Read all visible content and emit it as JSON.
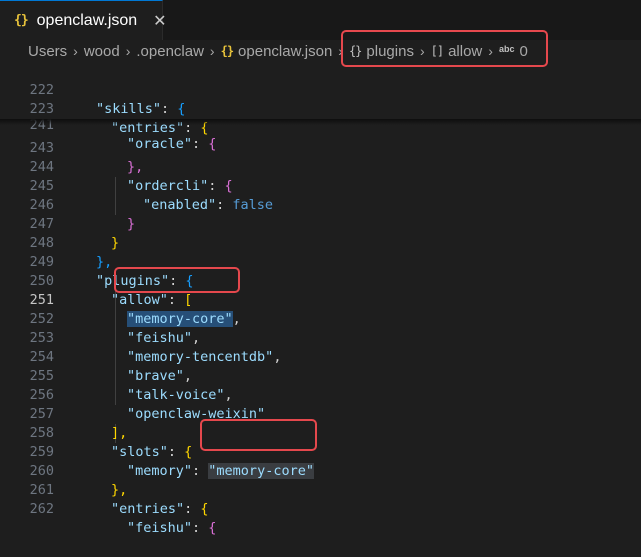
{
  "tab": {
    "icon": "{}",
    "title": "openclaw.json",
    "close": "✕"
  },
  "breadcrumb": {
    "items": [
      "Users",
      "wood",
      ".openclaw",
      "openclaw.json",
      "plugins",
      "allow",
      "0"
    ],
    "file_icon": "{}",
    "obj_icon": "{}",
    "arr_icon": "[]",
    "abc_icon": "abc",
    "separator": "›"
  },
  "editor": {
    "lines": [
      {
        "n": "222",
        "t": "\"skills\": {"
      },
      {
        "n": "223",
        "t": "\"entries\": {"
      },
      {
        "n": "241",
        "t": "\"oracle\": {"
      },
      {
        "n": "243",
        "t": "},"
      },
      {
        "n": "244",
        "t": "\"ordercli\": {"
      },
      {
        "n": "245",
        "t": "\"enabled\": false"
      },
      {
        "n": "246",
        "t": "}"
      },
      {
        "n": "247",
        "t": "}"
      },
      {
        "n": "248",
        "t": "},"
      },
      {
        "n": "249",
        "t": "\"plugins\": {"
      },
      {
        "n": "250",
        "t": "\"allow\": ["
      },
      {
        "n": "251",
        "t": "\"memory-core\","
      },
      {
        "n": "252",
        "t": "\"feishu\","
      },
      {
        "n": "253",
        "t": "\"memory-tencentdb\","
      },
      {
        "n": "254",
        "t": "\"brave\","
      },
      {
        "n": "255",
        "t": "\"talk-voice\","
      },
      {
        "n": "256",
        "t": "\"openclaw-weixin\""
      },
      {
        "n": "257",
        "t": "],"
      },
      {
        "n": "258",
        "t": "\"slots\": {"
      },
      {
        "n": "259",
        "t": "\"memory\": \"memory-core\""
      },
      {
        "n": "260",
        "t": "},"
      },
      {
        "n": "261",
        "t": "\"entries\": {"
      },
      {
        "n": "262",
        "t": "\"feishu\": {"
      }
    ],
    "tokens": {
      "skills": "\"skills\"",
      "entries": "\"entries\"",
      "oracle": "\"oracle\"",
      "ordercli": "\"ordercli\"",
      "enabled": "\"enabled\"",
      "false": "false",
      "plugins": "\"plugins\"",
      "allow": "\"allow\"",
      "memory_core": "\"memory-core\"",
      "feishu": "\"feishu\"",
      "memory_tencentdb": "\"memory-tencentdb\"",
      "brave": "\"brave\"",
      "talk_voice": "\"talk-voice\"",
      "openclaw_weixin": "\"openclaw-weixin\"",
      "slots": "\"slots\"",
      "memory": "\"memory\"",
      "colon": ": ",
      "comma": ",",
      "lbrace": "{",
      "rbrace": "}",
      "rbrace_comma": "},",
      "lbracket": "[",
      "rbracket_comma": "],"
    }
  },
  "colors": {
    "background": "#1e1e1e",
    "highlight": "#e5484d",
    "key": "#9cdcfe",
    "string": "#ce9178",
    "keyword": "#569cd6"
  }
}
